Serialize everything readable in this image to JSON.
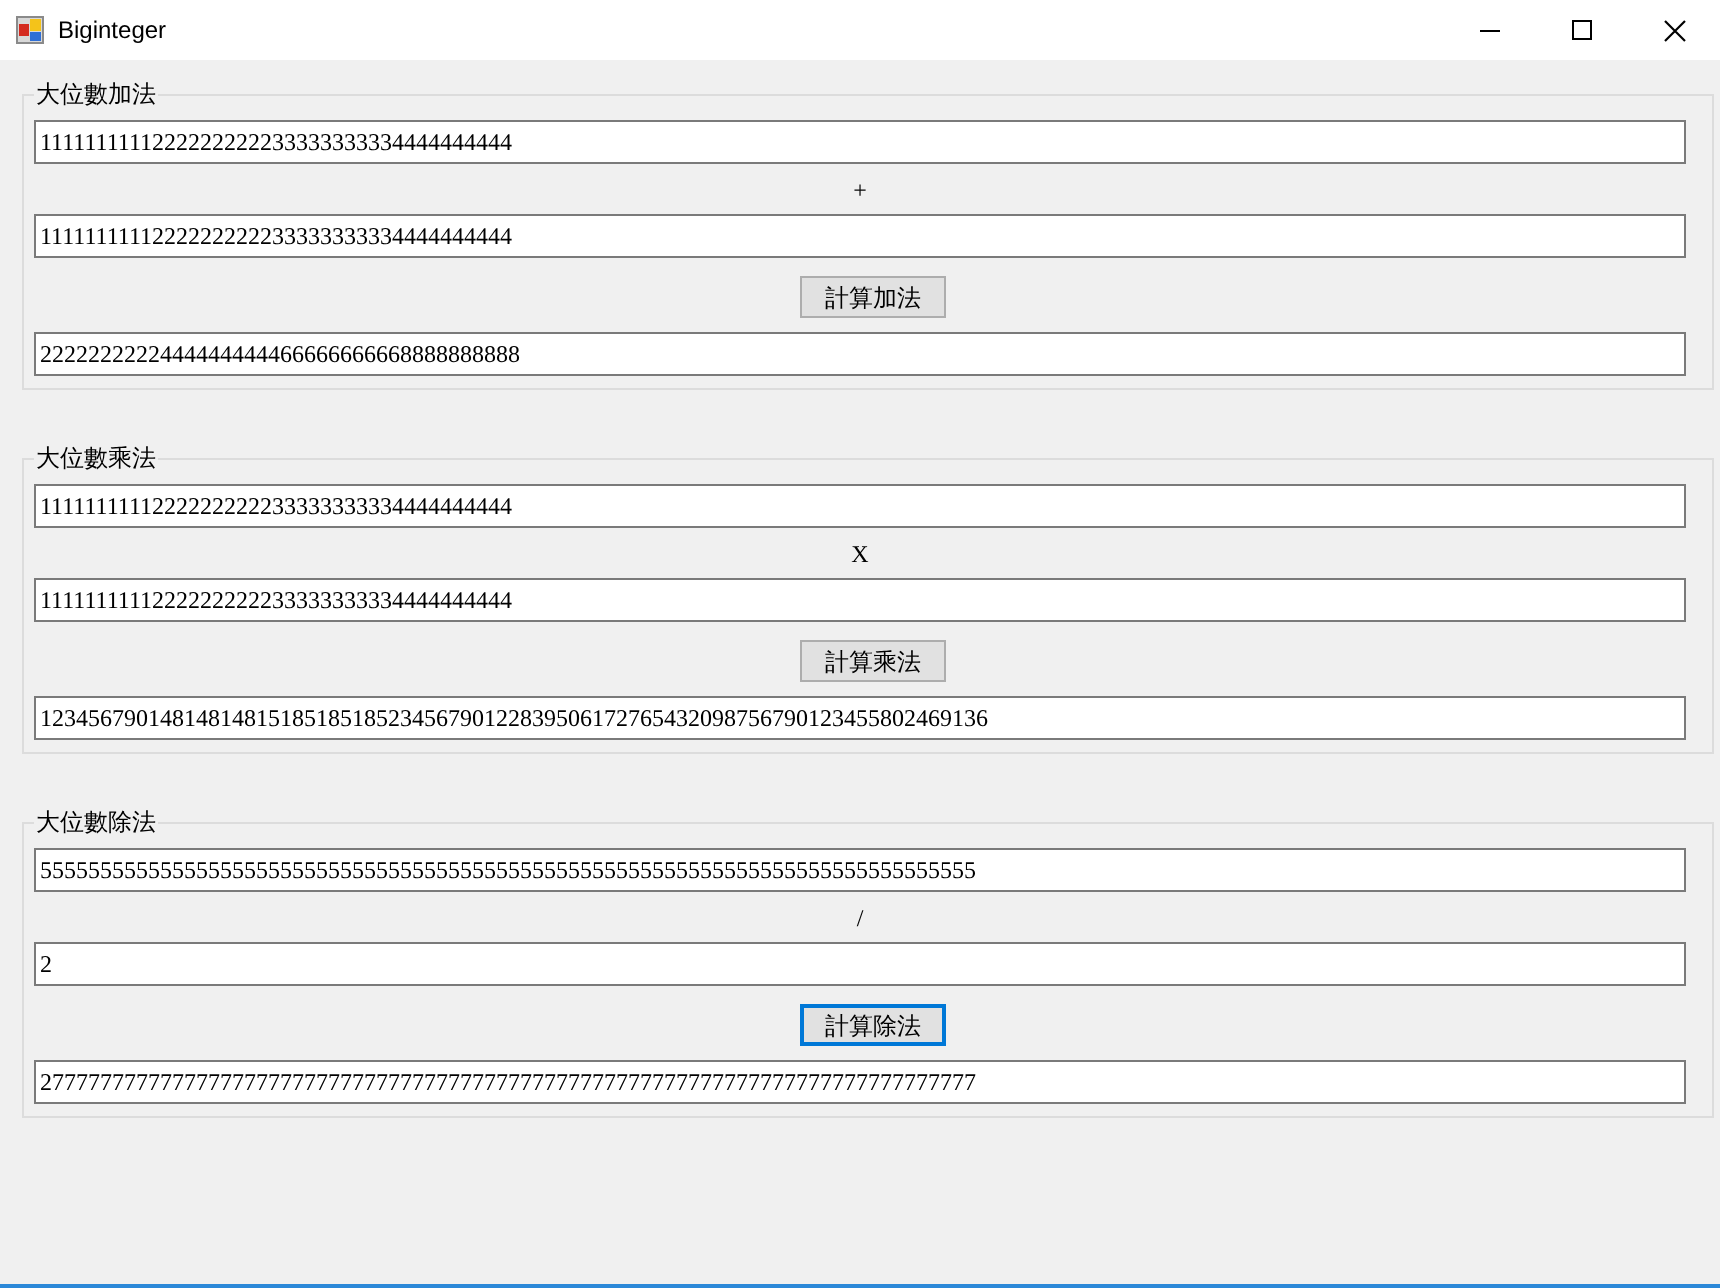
{
  "window": {
    "title": "Biginteger"
  },
  "groups": [
    {
      "title": "大位數加法",
      "operand_1": "1111111111222222222233333333334444444444",
      "operator": "+",
      "operand_2": "1111111111222222222233333333334444444444",
      "button": {
        "label": "計算加法",
        "focused": false
      },
      "result": "2222222222444444444466666666668888888888"
    },
    {
      "title": "大位數乘法",
      "operand_1": "1111111111222222222233333333334444444444",
      "operator": "X",
      "operand_2": "1111111111222222222233333333334444444444",
      "button": {
        "label": "計算乘法",
        "focused": false
      },
      "result": "1234567901481481481518518518523456790122839506172765432098756790123455802469136"
    },
    {
      "title": "大位數除法",
      "operand_1": "555555555555555555555555555555555555555555555555555555555555555555555555555555",
      "operator": "/",
      "operand_2": "2",
      "button": {
        "label": "計算除法",
        "focused": true
      },
      "result": "277777777777777777777777777777777777777777777777777777777777777777777777777777"
    }
  ]
}
